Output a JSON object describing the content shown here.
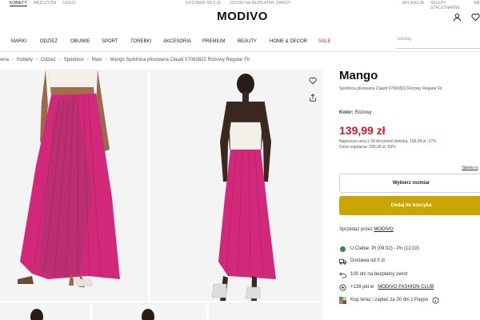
{
  "top_links": {
    "left": [
      "KOBIETY",
      "MĘŻCZYŹNI",
      "DZIECI"
    ],
    "center": [
      "DOSTAWA OD 0 ZŁ",
      "100 DNI NA BEZPŁATNY ZWROT"
    ],
    "right": [
      "APLIKACJA",
      "SKLEPY STACJONARNE",
      "ME"
    ]
  },
  "logo": "MODIVO",
  "header_icons": [
    "user-icon",
    "heart-icon"
  ],
  "nav": [
    "MARKI",
    "ODZIEŻ",
    "OBUWIE",
    "SPORT",
    "TOREBKI",
    "AKCESORIA",
    "PREMIUM",
    "BEAUTY",
    "HOME & DECOR",
    "SALE"
  ],
  "search": {
    "placeholder": "Szukaj"
  },
  "breadcrumb": [
    "wna",
    "Kobiety",
    "Odzież",
    "Spódnice",
    "Maxi",
    "Mango Spódnica plisowana Claudi 57063822 Różowy Regular Fit"
  ],
  "product": {
    "brand": "Mango",
    "subtitle": "Spódnica plisowana Claudi 57063822 Różowy Regular Fit",
    "color_label": "Kolor:",
    "color_value": "Różowy",
    "price": "139,99 zł",
    "lowest_price_note": "Najniższa cena z 30 dni przed obniżką: 169,99 zł",
    "lowest_price_discount": "-17%",
    "regular_price_note": "Cena regularna: 299,99 zł -53%",
    "size_table_link": "Tabela ro",
    "size_button": "Wybierz rozmiar",
    "cart_button": "Dodaj do koszyka",
    "sold_by_label": "Sprzedaż przez",
    "sold_by_value": "MODIVO"
  },
  "features": [
    {
      "icon": "green-dot-icon",
      "text": "U Ciebie: Pt (09.02) - Pn (12.02)"
    },
    {
      "icon": "truck-icon",
      "text": "Dostawa od 0 zł"
    },
    {
      "icon": "return-arrow-icon",
      "text": "100 dni na bezpłatny zwrot"
    },
    {
      "icon": "plus-circle-icon",
      "text": "+139 pkt w",
      "link": "MODIVO FASHION CLUB"
    },
    {
      "icon": "paypo-icon",
      "text": "Kup teraz i zapłać za 30 dni z Paypo"
    }
  ],
  "colors": {
    "price_red": "#d6192b",
    "cart_button": "#c8a700",
    "skirt_pink": "#d1287a",
    "status_green": "#3c8a4a"
  }
}
